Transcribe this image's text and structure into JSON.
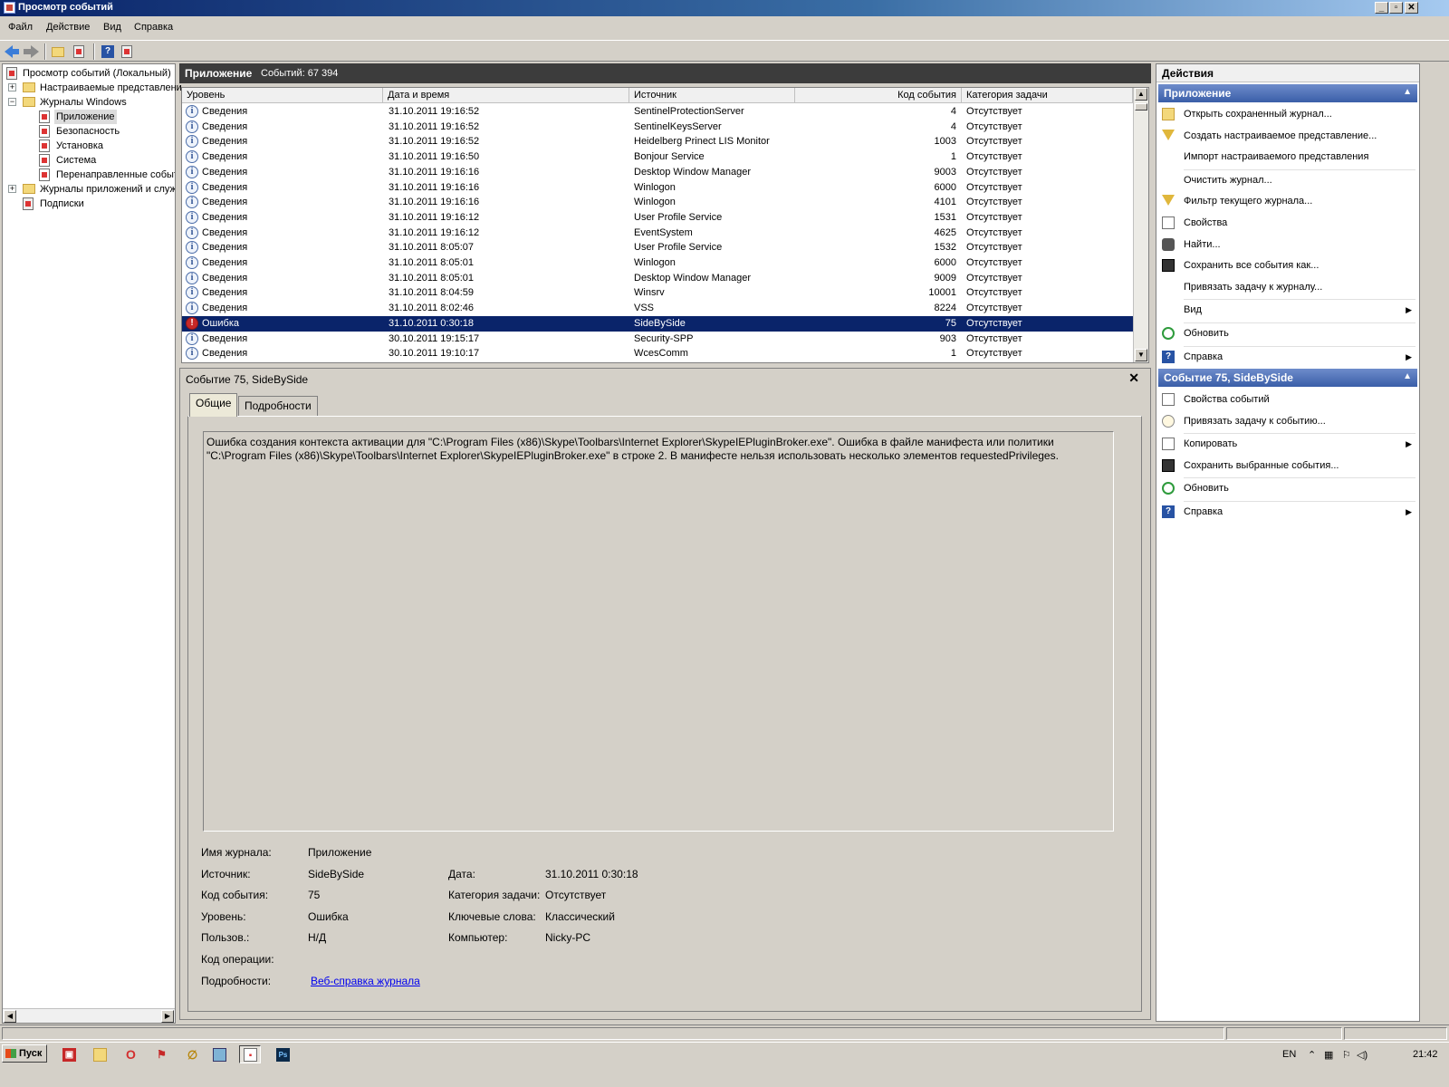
{
  "window": {
    "title": "Просмотр событий"
  },
  "menu": {
    "items": [
      "Файл",
      "Действие",
      "Вид",
      "Справка"
    ]
  },
  "tree": {
    "root": "Просмотр событий (Локальный)",
    "custom_views": "Настраиваемые представлени",
    "windows_logs": "Журналы Windows",
    "application": "Приложение",
    "security": "Безопасность",
    "setup": "Установка",
    "system": "Система",
    "forwarded": "Перенаправленные событ",
    "app_services": "Журналы приложений и служ",
    "subscriptions": "Подписки"
  },
  "center": {
    "title": "Приложение",
    "count": "Событий: 67 394"
  },
  "grid": {
    "columns": [
      "Уровень",
      "Дата и время",
      "Источник",
      "Код события",
      "Категория задачи"
    ],
    "rows": [
      {
        "level": "Сведения",
        "icon": "info-icon",
        "datetime": "31.10.2011 19:16:52",
        "source": "SentinelProtectionServer",
        "code": "4",
        "category": "Отсутствует"
      },
      {
        "level": "Сведения",
        "icon": "info-icon",
        "datetime": "31.10.2011 19:16:52",
        "source": "SentinelKeysServer",
        "code": "4",
        "category": "Отсутствует"
      },
      {
        "level": "Сведения",
        "icon": "info-icon",
        "datetime": "31.10.2011 19:16:52",
        "source": "Heidelberg Prinect LIS Monitor",
        "code": "1003",
        "category": "Отсутствует"
      },
      {
        "level": "Сведения",
        "icon": "info-icon",
        "datetime": "31.10.2011 19:16:50",
        "source": "Bonjour Service",
        "code": "1",
        "category": "Отсутствует"
      },
      {
        "level": "Сведения",
        "icon": "info-icon",
        "datetime": "31.10.2011 19:16:16",
        "source": "Desktop Window Manager",
        "code": "9003",
        "category": "Отсутствует"
      },
      {
        "level": "Сведения",
        "icon": "info-icon",
        "datetime": "31.10.2011 19:16:16",
        "source": "Winlogon",
        "code": "6000",
        "category": "Отсутствует"
      },
      {
        "level": "Сведения",
        "icon": "info-icon",
        "datetime": "31.10.2011 19:16:16",
        "source": "Winlogon",
        "code": "4101",
        "category": "Отсутствует"
      },
      {
        "level": "Сведения",
        "icon": "info-icon",
        "datetime": "31.10.2011 19:16:12",
        "source": "User Profile Service",
        "code": "1531",
        "category": "Отсутствует"
      },
      {
        "level": "Сведения",
        "icon": "info-icon",
        "datetime": "31.10.2011 19:16:12",
        "source": "EventSystem",
        "code": "4625",
        "category": "Отсутствует"
      },
      {
        "level": "Сведения",
        "icon": "info-icon",
        "datetime": "31.10.2011 8:05:07",
        "source": "User Profile Service",
        "code": "1532",
        "category": "Отсутствует"
      },
      {
        "level": "Сведения",
        "icon": "info-icon",
        "datetime": "31.10.2011 8:05:01",
        "source": "Winlogon",
        "code": "6000",
        "category": "Отсутствует"
      },
      {
        "level": "Сведения",
        "icon": "info-icon",
        "datetime": "31.10.2011 8:05:01",
        "source": "Desktop Window Manager",
        "code": "9009",
        "category": "Отсутствует"
      },
      {
        "level": "Сведения",
        "icon": "info-icon",
        "datetime": "31.10.2011 8:04:59",
        "source": "Winsrv",
        "code": "10001",
        "category": "Отсутствует"
      },
      {
        "level": "Сведения",
        "icon": "info-icon",
        "datetime": "31.10.2011 8:02:46",
        "source": "VSS",
        "code": "8224",
        "category": "Отсутствует"
      },
      {
        "level": "Ошибка",
        "icon": "error-icon",
        "datetime": "31.10.2011 0:30:18",
        "source": "SideBySide",
        "code": "75",
        "category": "Отсутствует",
        "selected": true
      },
      {
        "level": "Сведения",
        "icon": "info-icon",
        "datetime": "30.10.2011 19:15:17",
        "source": "Security-SPP",
        "code": "903",
        "category": "Отсутствует"
      },
      {
        "level": "Сведения",
        "icon": "info-icon",
        "datetime": "30.10.2011 19:10:17",
        "source": "WcesComm",
        "code": "1",
        "category": "Отсутствует"
      }
    ]
  },
  "details": {
    "title": "Событие 75, SideBySide",
    "close": "✕",
    "tabs": [
      "Общие",
      "Подробности"
    ],
    "message": "Ошибка создания контекста активации для \"C:\\Program Files (x86)\\Skype\\Toolbars\\Internet Explorer\\SkypeIEPluginBroker.exe\". Ошибка в файле манифеста или политики \"C:\\Program Files (x86)\\Skype\\Toolbars\\Internet Explorer\\SkypeIEPluginBroker.exe\" в строке 2. В манифесте нельзя использовать несколько элементов requestedPrivileges.",
    "props": {
      "log_name_label": "Имя журнала:",
      "log_name": "Приложение",
      "source_label": "Источник:",
      "source": "SideBySide",
      "date_label": "Дата:",
      "date": "31.10.2011 0:30:18",
      "event_id_label": "Код события:",
      "event_id": "75",
      "task_cat_label": "Категория задачи:",
      "task_cat": "Отсутствует",
      "level_label": "Уровень:",
      "level": "Ошибка",
      "keywords_label": "Ключевые слова:",
      "keywords": "Классический",
      "user_label": "Пользов.:",
      "user": "Н/Д",
      "computer_label": "Компьютер:",
      "computer": "Nicky-PC",
      "opcode_label": "Код операции:",
      "more_label": "Подробности:",
      "more_link": "Веб-справка журнала"
    }
  },
  "actions": {
    "header": "Действия",
    "section1": {
      "title": "Приложение",
      "items": [
        {
          "label": "Открыть сохраненный журнал...",
          "icon": "open-folder-icon"
        },
        {
          "label": "Создать настраиваемое представление...",
          "icon": "filter-icon"
        },
        {
          "label": "Импорт настраиваемого представления",
          "icon": ""
        },
        {
          "label": "Очистить журнал...",
          "icon": ""
        },
        {
          "label": "Фильтр текущего журнала...",
          "icon": "filter-icon"
        },
        {
          "label": "Свойства",
          "icon": "properties-icon"
        },
        {
          "label": "Найти...",
          "icon": "binoculars-icon"
        },
        {
          "label": "Сохранить все события как...",
          "icon": "save-icon"
        },
        {
          "label": "Привязать задачу к журналу...",
          "icon": ""
        },
        {
          "label": "Вид",
          "icon": "",
          "submenu": true
        },
        {
          "label": "Обновить",
          "icon": "refresh-icon"
        },
        {
          "label": "Справка",
          "icon": "help-icon",
          "submenu": true
        }
      ]
    },
    "section2": {
      "title": "Событие 75, SideBySide",
      "items": [
        {
          "label": "Свойства событий",
          "icon": "properties-icon"
        },
        {
          "label": "Привязать задачу к событию...",
          "icon": "task-clock-icon"
        },
        {
          "label": "Копировать",
          "icon": "copy-icon",
          "submenu": true
        },
        {
          "label": "Сохранить выбранные события...",
          "icon": "save-icon"
        },
        {
          "label": "Обновить",
          "icon": "refresh-icon"
        },
        {
          "label": "Справка",
          "icon": "help-icon",
          "submenu": true
        }
      ]
    }
  },
  "taskbar": {
    "start": "Пуск",
    "lang": "EN",
    "clock": "21:42"
  }
}
